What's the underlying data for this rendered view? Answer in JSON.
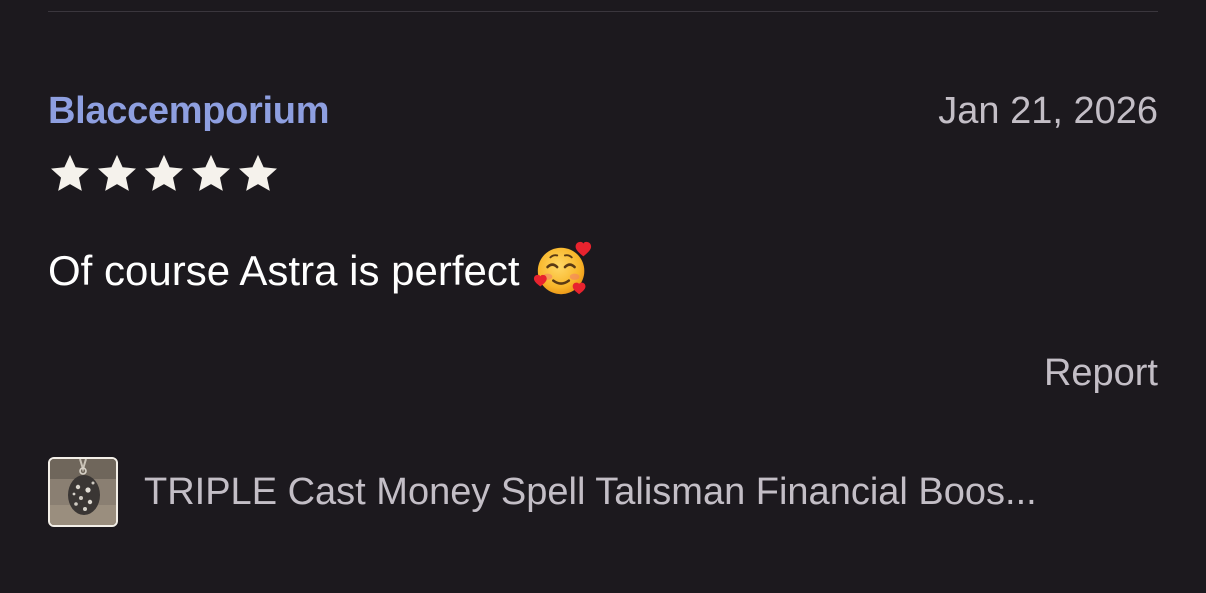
{
  "review": {
    "reviewer_name": "Blaccemporium",
    "date": "Jan 21, 2026",
    "rating": 5,
    "rating_max": 5,
    "text": "Of course Astra is perfect",
    "emoji": "smiling-face-with-hearts-emoji",
    "report_label": "Report"
  },
  "listing": {
    "title": "TRIPLE Cast Money Spell Talisman Financial Boos..."
  },
  "colors": {
    "background": "#1c191e",
    "reviewer_name": "#8e9fe0",
    "muted_text": "#c3bec6",
    "primary_text": "#ffffff",
    "star": "#f5f2ec"
  },
  "icons": {
    "star": "star-icon",
    "thumbnail": "pendant-stone-thumbnail"
  }
}
